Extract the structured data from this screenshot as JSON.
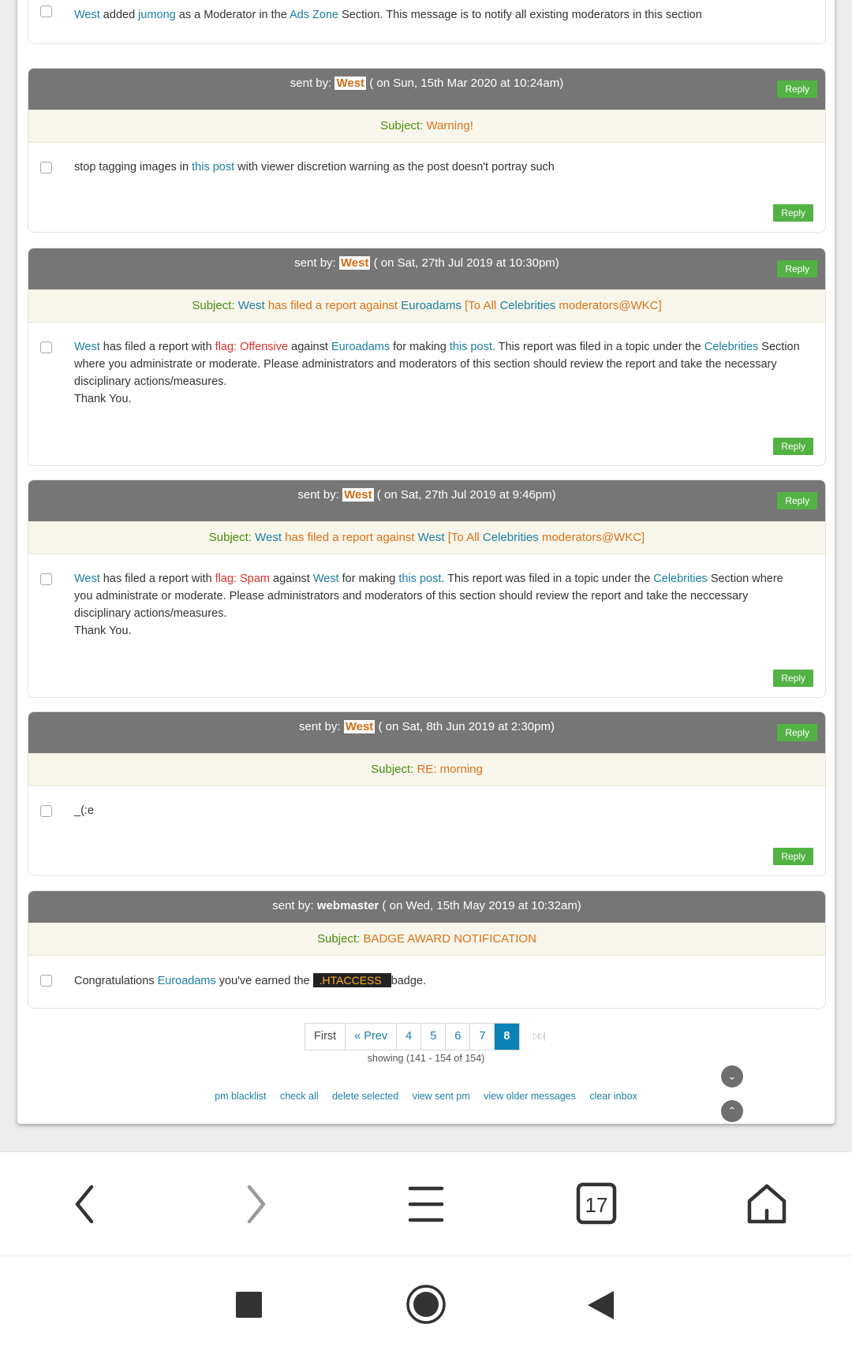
{
  "messages": {
    "top": {
      "actor": "West",
      "text1": " added ",
      "target": "jumong",
      "text2": " as a Moderator in the ",
      "section": "Ads Zone",
      "text3": " Section. This message is to notify all existing moderators in this section"
    },
    "m1": {
      "sent_by_label": "sent by:",
      "sender": "West",
      "date": " ( on Sun, 15th Mar 2020 at 10:24am)",
      "reply_label": "Reply",
      "subject_label": "Subject:",
      "subject": "Warning!",
      "body1": "stop tagging images in ",
      "body_link": "this post",
      "body2": " with viewer discretion warning as the post doesn't portray such"
    },
    "m2": {
      "sent_by_label": "sent by:",
      "sender": "West",
      "date": " ( on Sat, 27th Jul 2019 at 10:30pm)",
      "reply_label": "Reply",
      "subject_label": "Subject:",
      "subj_a": "West",
      "subj_b": " has filed a report against ",
      "subj_c": "Euroadams",
      "subj_d": " [To All ",
      "subj_e": "Celebrities",
      "subj_f": " moderators@WKC]",
      "b1": "West",
      "b2": " has filed a report with ",
      "b3": "flag: Offensive",
      "b4": " against ",
      "b5": "Euroadams",
      "b6": " for making ",
      "b7": "this post",
      "b8": ". This report was filed in a topic under the ",
      "b9": "Celebrities",
      "b10": " Section where you administrate or moderate. Please administrators and moderators of this section should review the report and take the necessary disciplinary actions/measures.",
      "thanks": "Thank You."
    },
    "m3": {
      "sent_by_label": "sent by:",
      "sender": "West",
      "date": " ( on Sat, 27th Jul 2019 at 9:46pm)",
      "reply_label": "Reply",
      "subject_label": "Subject:",
      "subj_a": "West",
      "subj_b": " has filed a report against ",
      "subj_c": "West",
      "subj_d": " [To All ",
      "subj_e": "Celebrities",
      "subj_f": " moderators@WKC]",
      "b1": "West",
      "b2": " has filed a report with ",
      "b3": "flag: Spam",
      "b4": " against ",
      "b5": "West",
      "b6": " for making ",
      "b7": "this post",
      "b8": ". This report was filed in a topic under the ",
      "b9": "Celebrities",
      "b10": " Section where you administrate or moderate. Please administrators and moderators of this section should review the report and take the neccessary disciplinary actions/measures.",
      "thanks": "Thank You."
    },
    "m4": {
      "sent_by_label": "sent by:",
      "sender": "West",
      "date": " ( on Sat, 8th Jun 2019 at 2:30pm)",
      "reply_label": "Reply",
      "subject_label": "Subject:",
      "subject": "RE: morning",
      "body": "_(:e"
    },
    "m5": {
      "sent_by_label": "sent by:",
      "sender": "webmaster",
      "date": " ( on Wed, 15th May 2019 at 10:32am)",
      "subject_label": "Subject:",
      "subject": "BADGE AWARD NOTIFICATION",
      "b1": "Congratulations ",
      "b2": "Euroadams",
      "b3": " you've earned the ",
      "badge": " .HTACCESS ",
      "b4": " badge."
    }
  },
  "pagination": {
    "first": "First",
    "prev": "« Prev",
    "pages": [
      "4",
      "5",
      "6",
      "7",
      "8"
    ],
    "active": "8",
    "showing": "showing (141 - 154 of 154)"
  },
  "footer_links": [
    "pm blacklist",
    "check all",
    "delete selected",
    "view sent pm",
    "view older messages",
    "clear inbox"
  ],
  "browser_nav": {
    "tab_count": "17"
  },
  "colors": {
    "header_bg": "#767676",
    "subject_bg": "#f8f6ea",
    "reply_green": "#53b244",
    "link_blue": "#1b7fa3",
    "accent_orange": "#d9721c",
    "flag_red": "#d9322c",
    "pager_active": "#0a82b8"
  }
}
